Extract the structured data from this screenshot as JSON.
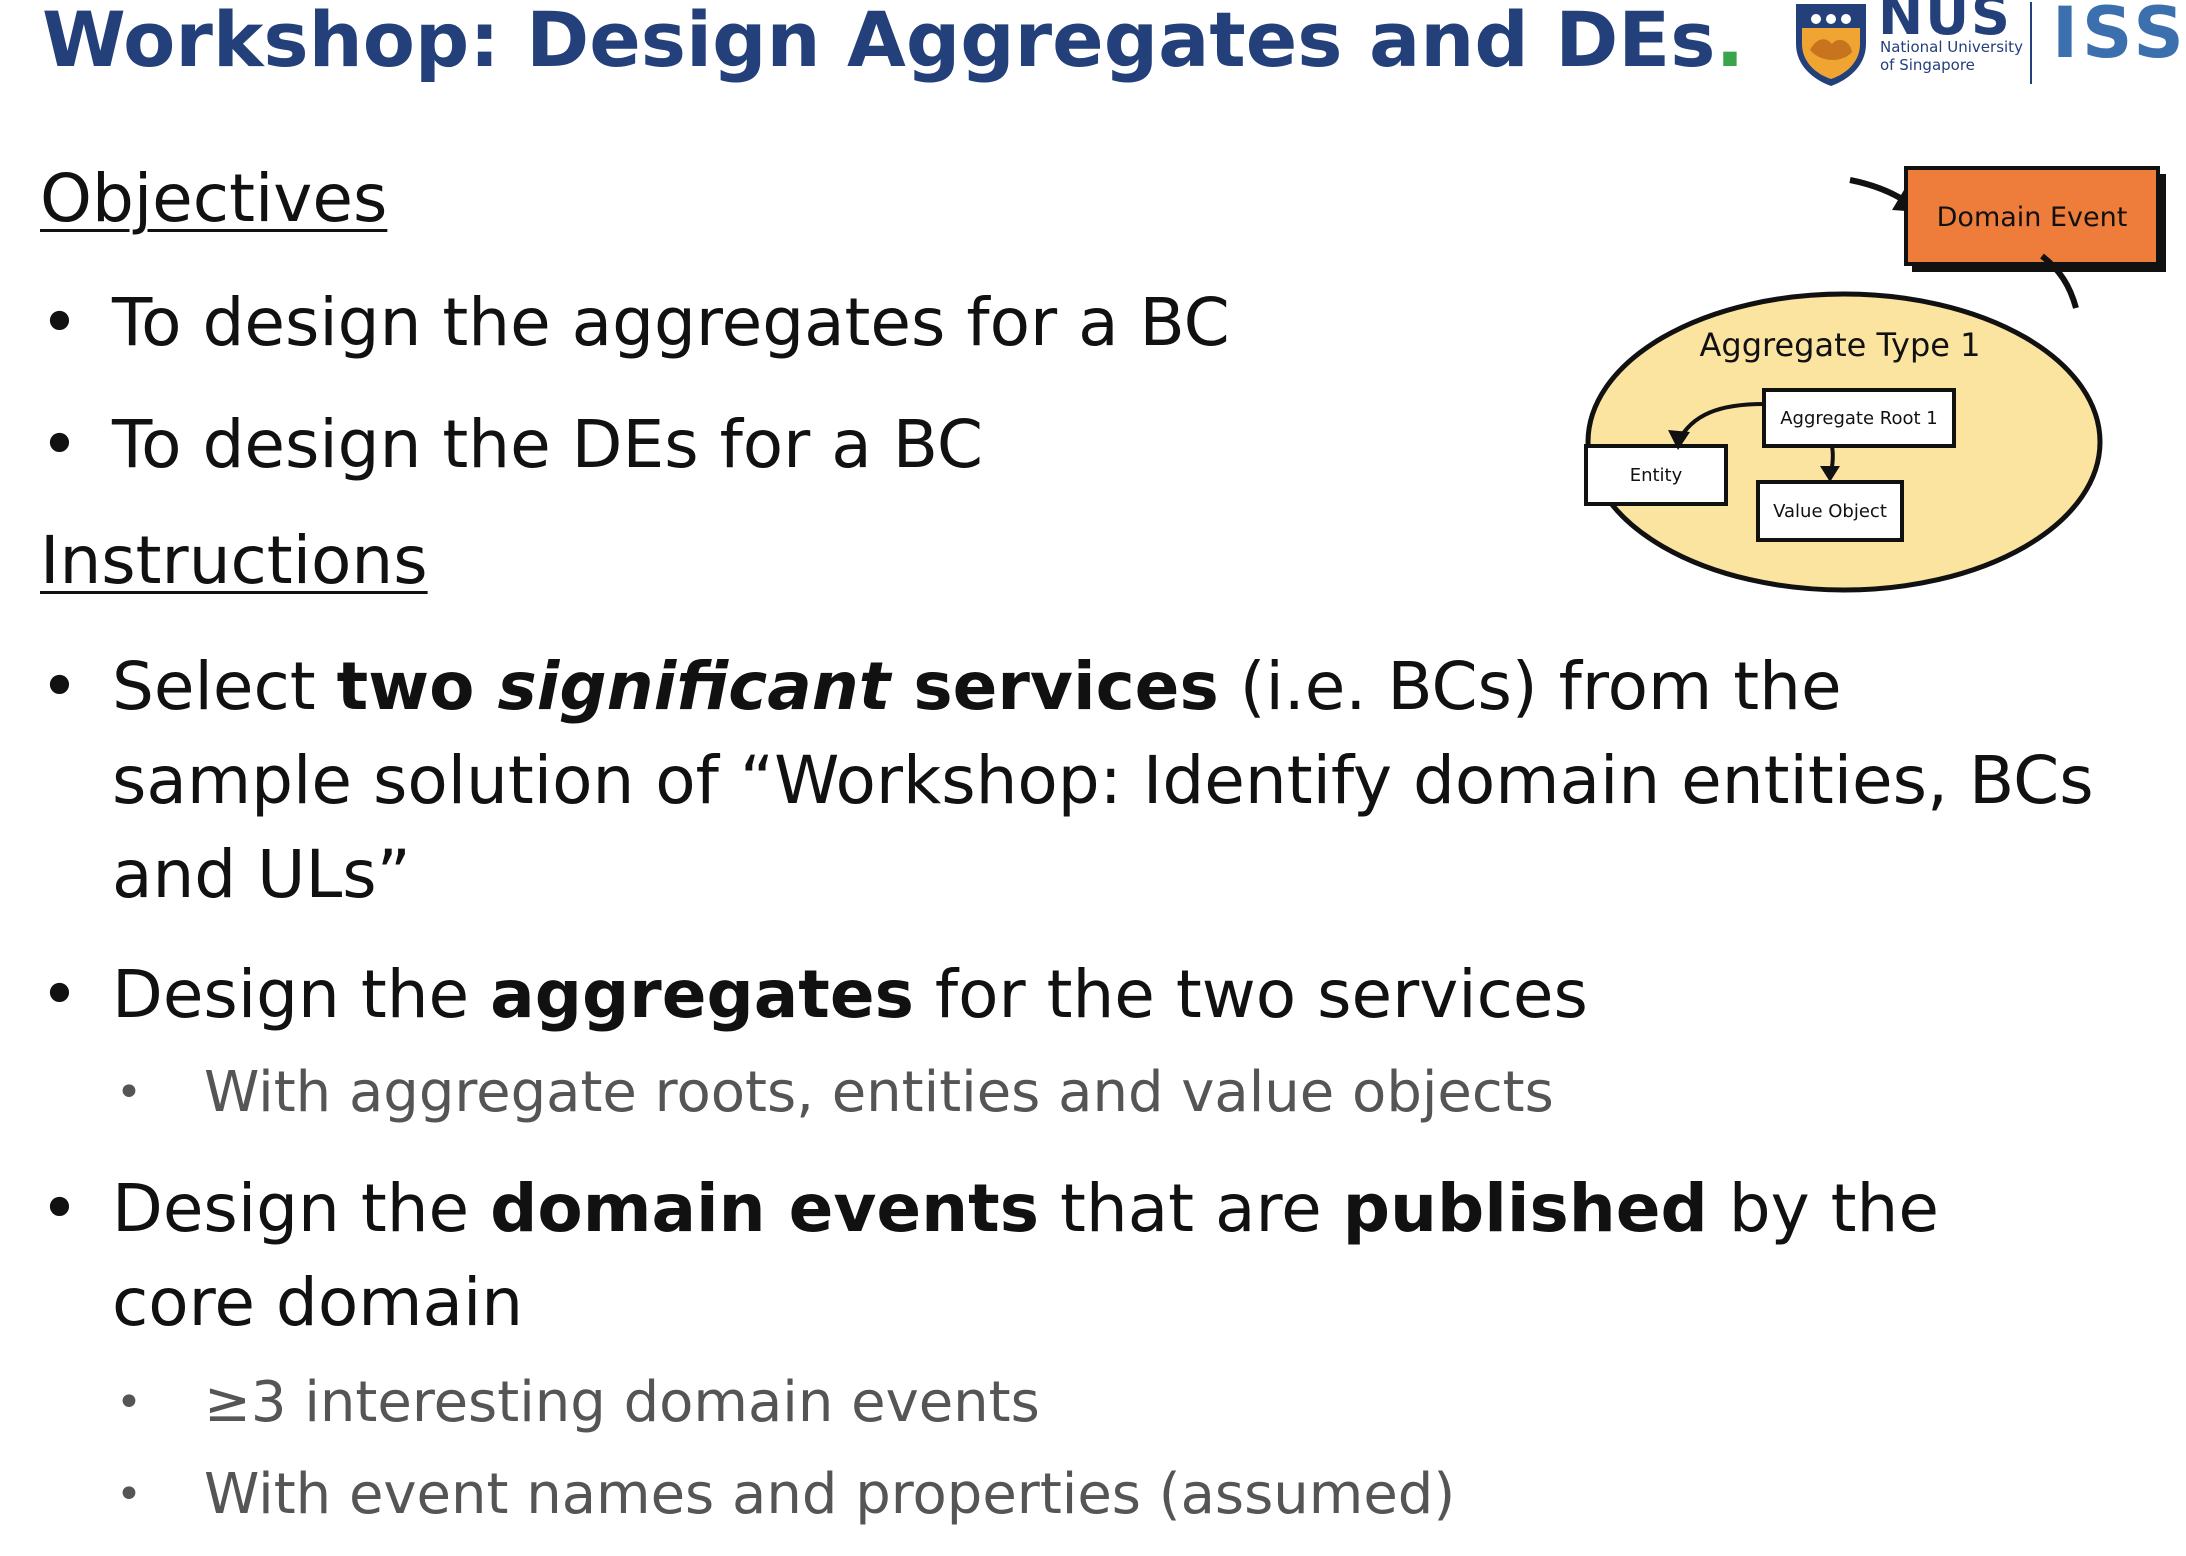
{
  "slide": {
    "title": "Workshop: Design Aggregates and DEs",
    "title_suffix": ".",
    "colors": {
      "title": "#24407a",
      "accent_dot": "#3aa44b",
      "event_box": "#ee7d3b",
      "aggregate_fill": "#fbe3a0"
    }
  },
  "logos": {
    "nus": {
      "word": "NUS",
      "line1": "National University",
      "line2": "of Singapore",
      "icon": "nus-crest-icon"
    },
    "iss": {
      "word": "ISS"
    }
  },
  "objectives": {
    "heading": "Objectives",
    "items": [
      "To design the aggregates for a BC",
      "To design the DEs for a BC"
    ]
  },
  "instructions": {
    "heading": "Instructions",
    "item1": {
      "pre": "Select ",
      "bold1": "two ",
      "bolditalic": "significant",
      "bold2": " services",
      "rest": " (i.e. BCs) from the sample solution of “Workshop: Identify domain entities, BCs and ULs”"
    },
    "item2": {
      "pre": "Design the ",
      "bold": "aggregates",
      "rest": " for the two services",
      "sub": "With aggregate roots, entities and value objects"
    },
    "item3": {
      "pre": "Design the ",
      "bold1": "domain events",
      "mid": " that are ",
      "bold2": "published",
      "rest": " by the core domain",
      "subs": [
        "≥3 interesting domain events",
        "With event names and properties (assumed)"
      ]
    }
  },
  "diagram": {
    "event_label": "Domain Event",
    "aggregate_label": "Aggregate Type 1",
    "root_label": "Aggregate Root 1",
    "entity_label": "Entity",
    "value_object_label": "Value Object"
  }
}
